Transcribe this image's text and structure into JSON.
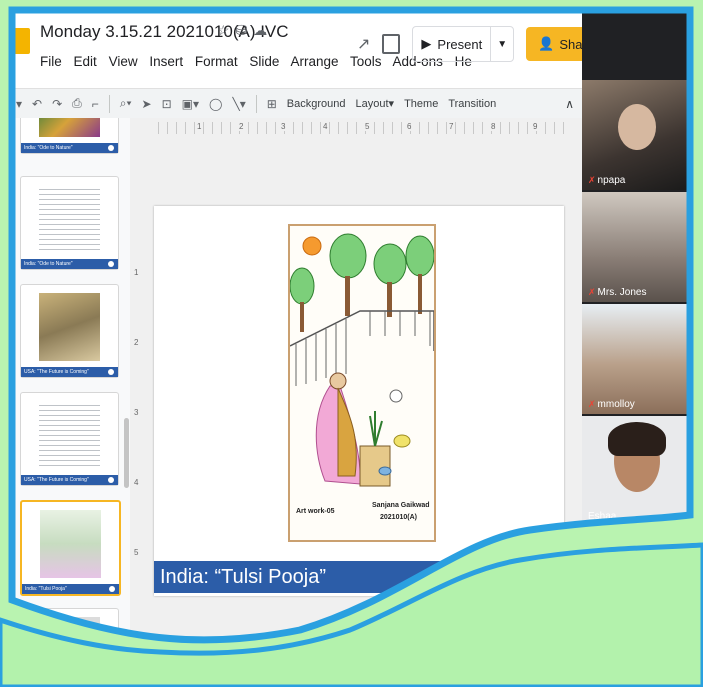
{
  "doc": {
    "title": "Monday 3.15.21 2021010(A) IVC",
    "menus": [
      "File",
      "Edit",
      "View",
      "Insert",
      "Format",
      "Slide",
      "Arrange",
      "Tools",
      "Add-ons",
      "He"
    ],
    "present_label": "Present",
    "share_label": "Share"
  },
  "toolbar": {
    "background_label": "Background",
    "layout_label": "Layout",
    "theme_label": "Theme",
    "transition_label": "Transition"
  },
  "ruler": {
    "h_ticks": [
      "1",
      "2",
      "3",
      "4",
      "5",
      "6",
      "7",
      "8",
      "9"
    ],
    "v_ticks": [
      "1",
      "2",
      "3",
      "4",
      "5"
    ]
  },
  "thumbnails": [
    {
      "caption": "India: \"Ode to Nature\""
    },
    {
      "caption": "India: \"Ode to Nature\""
    },
    {
      "caption": "USA: \"The Future is Coming\""
    },
    {
      "caption": "USA: \"The Future is Coming\""
    },
    {
      "caption": "India: \"Tulsi Pooja\""
    }
  ],
  "slide": {
    "artwork_label": "Art work-05",
    "artist_name": "Sanjana Gaikwad",
    "artist_class": "2021010(A)",
    "title": "India: “Tulsi Pooja”"
  },
  "participants": [
    {
      "name": "npapa"
    },
    {
      "name": "Mrs. Jones"
    },
    {
      "name": "mmolloy"
    },
    {
      "name": "Eshaa"
    }
  ],
  "colors": {
    "accent": "#f6b623",
    "slide_banner": "#2c5da8",
    "wave": "#2aa0e0",
    "background": "#b9f3b0"
  }
}
